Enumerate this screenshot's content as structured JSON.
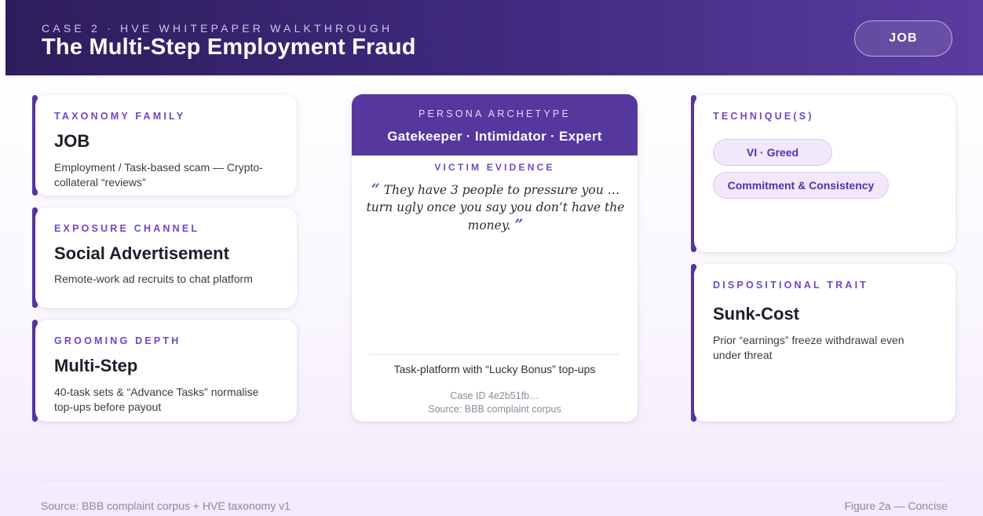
{
  "header": {
    "kicker": "CASE 2 · HVE WHITEPAPER WALKTHROUGH",
    "title": "The Multi-Step Employment Fraud",
    "badge": "JOB"
  },
  "left_cards": [
    {
      "label": "TAXONOMY FAMILY",
      "value": "JOB",
      "desc_lines": [
        "Employment / Task-based scam — Crypto-",
        "collateral “reviews”"
      ]
    },
    {
      "label": "EXPOSURE CHANNEL",
      "value": "Social Advertisement",
      "desc_lines": [
        "Remote-work ad recruits to chat platform"
      ]
    },
    {
      "label": "GROOMING DEPTH",
      "value": "Multi-Step",
      "desc_lines": [
        "40-task sets & “Advance Tasks” normalise",
        "top-ups before payout"
      ]
    }
  ],
  "center": {
    "persona_label": "PERSONA ARCHETYPE",
    "persona_value": "Gatekeeper · Intimidator · Expert",
    "evidence_label": "VICTIM EVIDENCE",
    "open_quote": "“",
    "close_quote": "”",
    "quote_lines": [
      "They have 3 people to pressure you …",
      "turn ugly once you say you don’t have the",
      "money."
    ],
    "summary": "Task-platform with “Lucky Bonus” top-ups",
    "case_id": "Case ID 4e2b51fb…",
    "source": "Source: BBB complaint corpus"
  },
  "right_cards": {
    "techniques_label": "TECHNIQUE(S)",
    "chips": [
      "VI · Greed",
      "Commitment & Consistency"
    ],
    "trait_label": "DISPOSITIONAL TRAIT",
    "trait_value": "Sunk-Cost",
    "trait_desc_lines": [
      "Prior “earnings” freeze withdrawal even",
      "under threat"
    ]
  },
  "footer": {
    "source": "Source: BBB complaint corpus + HVE taxonomy v1",
    "figure": "Figure 2a — Concise"
  },
  "colors": {
    "accent": "#56379e",
    "label": "#6f48c6",
    "chip_bg": "#f1e8fc",
    "chip_text": "#5a2ea8"
  }
}
